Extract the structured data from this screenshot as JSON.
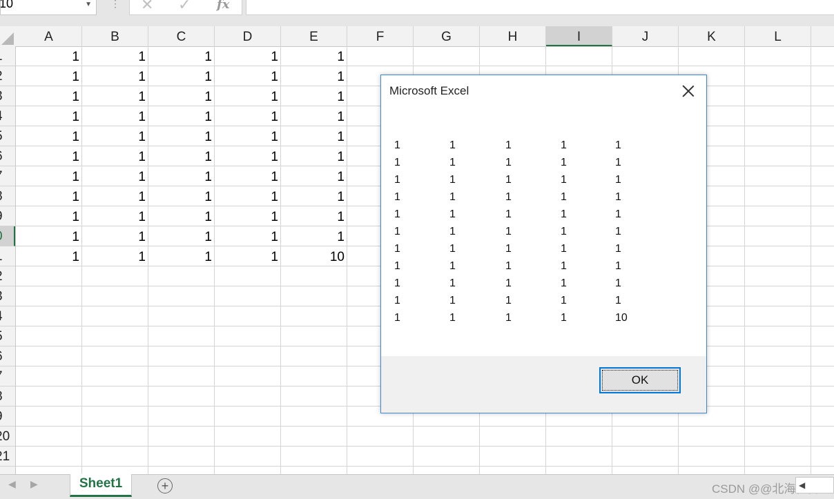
{
  "formula_bar": {
    "name_box": "10",
    "dots": "⋮",
    "cancel_glyph": "✕",
    "enter_glyph": "✓",
    "fx_label": "fx",
    "formula": ""
  },
  "grid": {
    "columns": [
      "A",
      "B",
      "C",
      "D",
      "E",
      "F",
      "G",
      "H",
      "I",
      "J",
      "K",
      "L"
    ],
    "selected_column": "I",
    "row_labels": [
      "1",
      "2",
      "3",
      "4",
      "5",
      "6",
      "7",
      "8",
      "9",
      "0",
      "1",
      "2",
      "3",
      "4",
      "5",
      "6",
      "7",
      "8",
      "9",
      "20",
      "21"
    ],
    "selected_row_index": 9,
    "cells": [
      [
        "1",
        "1",
        "1",
        "1",
        "1"
      ],
      [
        "1",
        "1",
        "1",
        "1",
        "1"
      ],
      [
        "1",
        "1",
        "1",
        "1",
        "1"
      ],
      [
        "1",
        "1",
        "1",
        "1",
        "1"
      ],
      [
        "1",
        "1",
        "1",
        "1",
        "1"
      ],
      [
        "1",
        "1",
        "1",
        "1",
        "1"
      ],
      [
        "1",
        "1",
        "1",
        "1",
        "1"
      ],
      [
        "1",
        "1",
        "1",
        "1",
        "1"
      ],
      [
        "1",
        "1",
        "1",
        "1",
        "1"
      ],
      [
        "1",
        "1",
        "1",
        "1",
        "1"
      ],
      [
        "1",
        "1",
        "1",
        "1",
        "10"
      ]
    ]
  },
  "tabs": {
    "prev_glyph": "◀",
    "next_glyph": "▶",
    "sheet": "Sheet1",
    "add_glyph": "+",
    "watermark": "CSDN @@北海怪兽",
    "scroll_glyph": "◀"
  },
  "dialog": {
    "title": "Microsoft Excel",
    "message_rows": [
      [
        "1",
        "1",
        "1",
        "1",
        "1"
      ],
      [
        "1",
        "1",
        "1",
        "1",
        "1"
      ],
      [
        "1",
        "1",
        "1",
        "1",
        "1"
      ],
      [
        "1",
        "1",
        "1",
        "1",
        "1"
      ],
      [
        "1",
        "1",
        "1",
        "1",
        "1"
      ],
      [
        "1",
        "1",
        "1",
        "1",
        "1"
      ],
      [
        "1",
        "1",
        "1",
        "1",
        "1"
      ],
      [
        "1",
        "1",
        "1",
        "1",
        "1"
      ],
      [
        "1",
        "1",
        "1",
        "1",
        "1"
      ],
      [
        "1",
        "1",
        "1",
        "1",
        "1"
      ],
      [
        "1",
        "1",
        "1",
        "1",
        "10"
      ]
    ],
    "ok_label": "OK"
  },
  "colors": {
    "accent_green": "#217346",
    "dialog_border": "#3c8ad6",
    "button_focus": "#0078d7"
  }
}
